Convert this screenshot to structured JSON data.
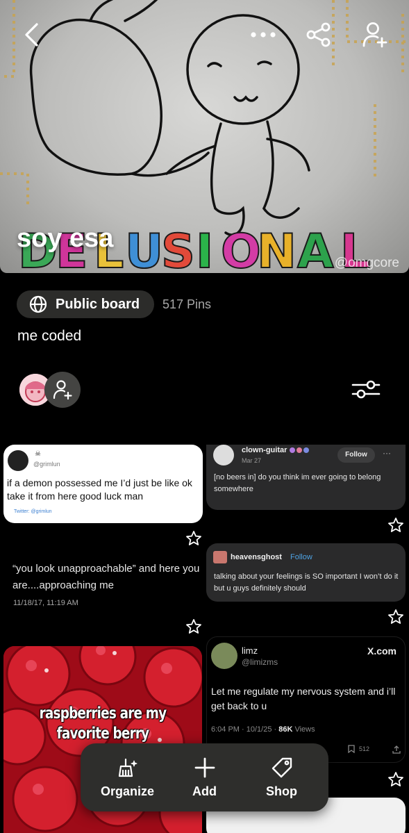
{
  "board": {
    "title": "soy esa",
    "watermark": "@omgcore",
    "visibility_label": "Public board",
    "pin_count": "517 Pins",
    "description": "me coded"
  },
  "header_icons": [
    "back-icon",
    "more-icon",
    "share-icon",
    "add-collaborator-icon"
  ],
  "cover_art_text": "DELUSIONAL",
  "pins": {
    "grimlun": {
      "handle": "@grimlun",
      "text": "if a demon possessed me I’d just be like ok take it from here good luck man",
      "source": "Twitter: @grimlun"
    },
    "clown": {
      "name": "clown-guitar",
      "date": "Mar 27",
      "follow": "Follow",
      "text": "[no beers in] do you think im ever going to belong somewhere"
    },
    "quote": {
      "text": "“you look unapproachable” and here you are....approaching me",
      "timestamp": "11/18/17, 11:19 AM"
    },
    "heavens": {
      "name": "heavensghost",
      "follow": "Follow",
      "text": "talking about your feelings is SO important I won’t do it but u guys definitely should"
    },
    "rasp": {
      "line1": "raspberries are my",
      "line2": "favorite berry"
    },
    "limz": {
      "name": "limz",
      "handle": "@limizms",
      "site": "X.com",
      "text": "Let me regulate my nervous system and i’ll get back to u",
      "time": "6:04 PM · 10/1/25 · ",
      "views_count": "86K",
      "views_label": " Views",
      "bookmarks": "512"
    }
  },
  "toolbar": {
    "organize": "Organize",
    "add": "Add",
    "shop": "Shop"
  },
  "colors": {
    "background": "#000000",
    "pill": "#2c2c2a",
    "card_dark": "#2a2a2b",
    "toolbar": "#2e2e2c",
    "follow_blue": "#4ea3e3"
  }
}
